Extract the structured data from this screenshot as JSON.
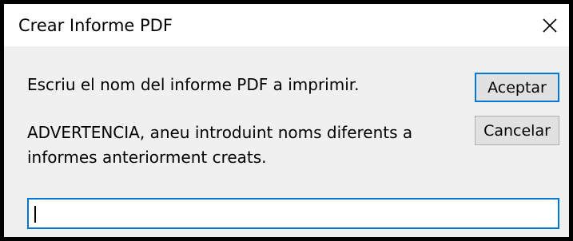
{
  "window": {
    "title": "Crear Informe PDF",
    "close_icon": "close-icon"
  },
  "dialog": {
    "message": "Escriu el nom del informe PDF a imprimir.",
    "warning_line1": "ADVERTENCIA, aneu introduint noms diferents a",
    "warning_line2": "informes anteriorment creats."
  },
  "buttons": {
    "accept_label": "Aceptar",
    "cancel_label": "Cancelar"
  },
  "input": {
    "value": ""
  },
  "colors": {
    "focus_accent": "#0078d7",
    "dialog_bg": "#f0f0f0",
    "titlebar_bg": "#ffffff"
  }
}
